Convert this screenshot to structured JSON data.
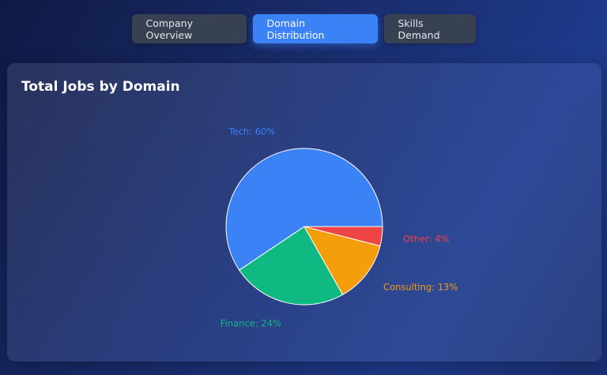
{
  "tabs": [
    {
      "label": "Company Overview",
      "active": false
    },
    {
      "label": "Domain Distribution",
      "active": true
    },
    {
      "label": "Skills Demand",
      "active": false
    }
  ],
  "card": {
    "title": "Total Jobs by Domain"
  },
  "colors": {
    "tech": "#3b82f6",
    "finance": "#10b981",
    "consulting": "#f59e0b",
    "other": "#ef4444",
    "active_tab": "#3b82f6",
    "inactive_tab": "#374151"
  },
  "chart_data": {
    "type": "pie",
    "title": "Total Jobs by Domain",
    "slices": [
      {
        "name": "Tech",
        "value": 60,
        "label": "Tech: 60%",
        "color": "#3b82f6"
      },
      {
        "name": "Finance",
        "value": 24,
        "label": "Finance: 24%",
        "color": "#10b981"
      },
      {
        "name": "Consulting",
        "value": 13,
        "label": "Consulting: 13%",
        "color": "#f59e0b"
      },
      {
        "name": "Other",
        "value": 4,
        "label": "Other: 4%",
        "color": "#ef4444"
      }
    ]
  }
}
